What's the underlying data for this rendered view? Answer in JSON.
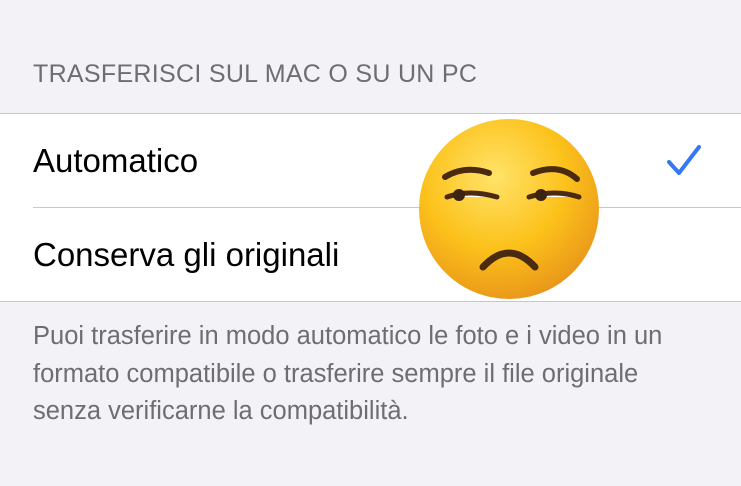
{
  "section": {
    "header": "TRASFERISCI SUL MAC O SU UN PC"
  },
  "options": [
    {
      "label": "Automatico",
      "selected": true
    },
    {
      "label": "Conserva gli originali",
      "selected": false
    }
  ],
  "footer": {
    "text": "Puoi trasferire in modo automatico le foto e i video in un formato compatibile o trasferire sempre il file originale senza verificarne la compatibilità."
  },
  "icons": {
    "checkmark": "checkmark-icon",
    "overlay": "unamused-face-emoji"
  },
  "colors": {
    "accent": "#3478f6",
    "background": "#f2f2f7",
    "secondary_text": "#6d6d72",
    "separator": "#c8c7cc"
  }
}
